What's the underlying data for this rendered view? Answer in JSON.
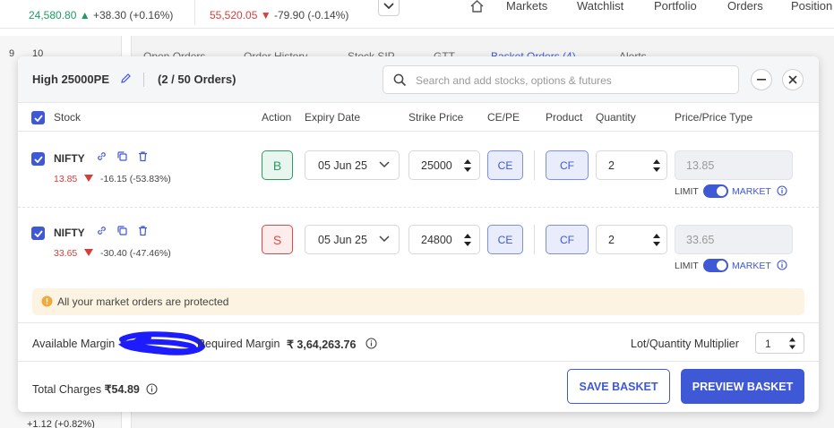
{
  "header": {
    "indices": [
      {
        "value": "24,580.80",
        "change": "+38.30 (+0.16%)",
        "direction": "up"
      },
      {
        "value": "55,520.05",
        "change": "-79.90 (-0.14%)",
        "direction": "down"
      }
    ],
    "nav": [
      "Markets",
      "Watchlist",
      "Portfolio",
      "Orders",
      "Position"
    ]
  },
  "left_panel": {
    "tabs": [
      "9",
      "10"
    ],
    "bottom_change": "+1.12 (+0.82%)"
  },
  "background_tabs": [
    "Open Orders",
    "Order History",
    "Stock SIP",
    "GTT",
    "Basket Orders (4)",
    "Alerts"
  ],
  "modal": {
    "title": "High 25000PE",
    "order_count": "(2 / 50 Orders)",
    "search_placeholder": "Search and add stocks, options & futures",
    "columns": {
      "stock": "Stock",
      "action": "Action",
      "expiry": "Expiry Date",
      "strike": "Strike Price",
      "cepe": "CE/PE",
      "product": "Product",
      "quantity": "Quantity",
      "price": "Price/Price Type"
    },
    "rows": [
      {
        "symbol": "NIFTY",
        "ltp": "13.85",
        "change": "-16.15 (-53.83%)",
        "action": "B",
        "expiry": "05 Jun 25",
        "strike": "25000",
        "option_type": "CE",
        "product": "CF",
        "quantity": "2",
        "price": "13.85",
        "limit_label": "LIMIT",
        "market_label": "MARKET"
      },
      {
        "symbol": "NIFTY",
        "ltp": "33.65",
        "change": "-30.40 (-47.46%)",
        "action": "S",
        "expiry": "05 Jun 25",
        "strike": "24800",
        "option_type": "CE",
        "product": "CF",
        "quantity": "2",
        "price": "33.65",
        "limit_label": "LIMIT",
        "market_label": "MARKET"
      }
    ],
    "notice": "All your market orders are protected",
    "available_margin_label": "Available Margin",
    "available_margin_prefix": "₹",
    "required_margin_label": "Required Margin",
    "required_margin_value": "₹ 3,64,263.76",
    "multiplier_label": "Lot/Quantity Multiplier",
    "multiplier_value": "1",
    "total_charges_label": "Total Charges",
    "total_charges_value": "₹54.89",
    "save_button": "SAVE BASKET",
    "preview_button": "PREVIEW BASKET"
  },
  "colors": {
    "accent": "#3f58d5",
    "buy": "#2e9a62",
    "sell": "#d94a4a",
    "up": "#1e9b63",
    "down": "#d43f3a",
    "notice_bg": "#fdf3e2",
    "redaction": "#1c1cff"
  }
}
